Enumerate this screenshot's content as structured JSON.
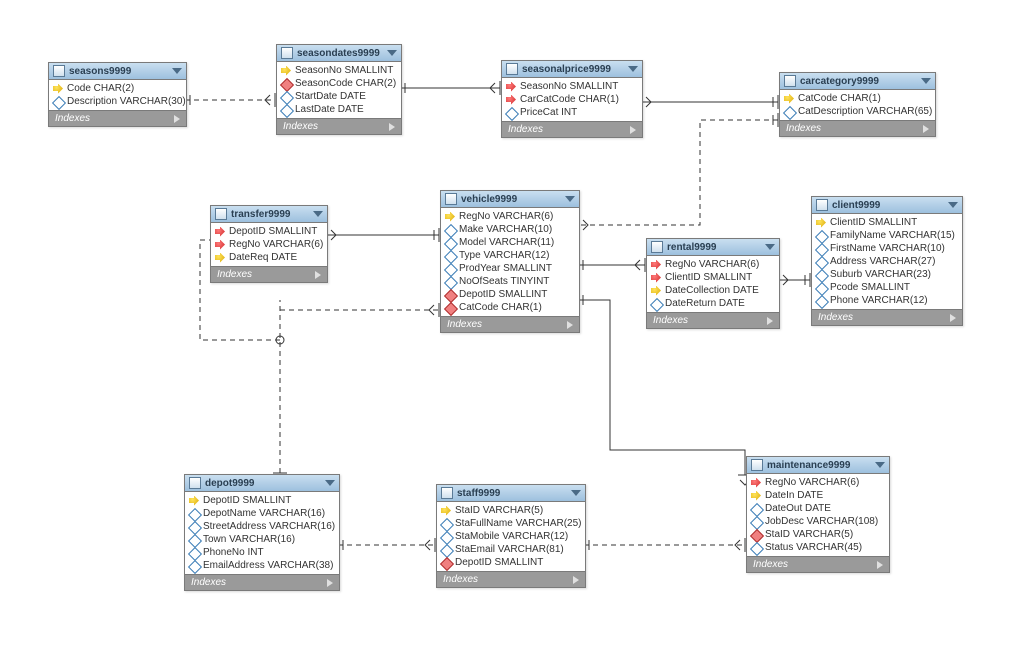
{
  "tables": {
    "seasons": {
      "title": "seasons9999",
      "cols": [
        {
          "icon": "key yellow",
          "text": "Code CHAR(2)"
        },
        {
          "icon": "diamond hollow",
          "text": "Description VARCHAR(30)"
        }
      ],
      "footer": "Indexes"
    },
    "seasondates": {
      "title": "seasondates9999",
      "cols": [
        {
          "icon": "key yellow",
          "text": "SeasonNo SMALLINT"
        },
        {
          "icon": "diamond red",
          "text": "SeasonCode CHAR(2)"
        },
        {
          "icon": "diamond hollow",
          "text": "StartDate DATE"
        },
        {
          "icon": "diamond hollow",
          "text": "LastDate DATE"
        }
      ],
      "footer": "Indexes"
    },
    "seasonalprice": {
      "title": "seasonalprice9999",
      "cols": [
        {
          "icon": "key red",
          "text": "SeasonNo SMALLINT"
        },
        {
          "icon": "key red",
          "text": "CarCatCode CHAR(1)"
        },
        {
          "icon": "diamond hollow",
          "text": "PriceCat INT"
        }
      ],
      "footer": "Indexes"
    },
    "carcategory": {
      "title": "carcategory9999",
      "cols": [
        {
          "icon": "key yellow",
          "text": "CatCode CHAR(1)"
        },
        {
          "icon": "diamond hollow",
          "text": "CatDescription VARCHAR(65)"
        }
      ],
      "footer": "Indexes"
    },
    "transfer": {
      "title": "transfer9999",
      "cols": [
        {
          "icon": "key red",
          "text": "DepotID SMALLINT"
        },
        {
          "icon": "key red",
          "text": "RegNo VARCHAR(6)"
        },
        {
          "icon": "key yellow",
          "text": "DateReq DATE"
        }
      ],
      "footer": "Indexes"
    },
    "vehicle": {
      "title": "vehicle9999",
      "cols": [
        {
          "icon": "key yellow",
          "text": "RegNo VARCHAR(6)"
        },
        {
          "icon": "diamond hollow",
          "text": "Make VARCHAR(10)"
        },
        {
          "icon": "diamond hollow",
          "text": "Model VARCHAR(11)"
        },
        {
          "icon": "diamond hollow",
          "text": "Type VARCHAR(12)"
        },
        {
          "icon": "diamond hollow",
          "text": "ProdYear SMALLINT"
        },
        {
          "icon": "diamond hollow",
          "text": "NoOfSeats TINYINT"
        },
        {
          "icon": "diamond red",
          "text": "DepotID SMALLINT"
        },
        {
          "icon": "diamond red",
          "text": "CatCode CHAR(1)"
        }
      ],
      "footer": "Indexes"
    },
    "rental": {
      "title": "rental9999",
      "cols": [
        {
          "icon": "key red",
          "text": "RegNo VARCHAR(6)"
        },
        {
          "icon": "key red",
          "text": "ClientID SMALLINT"
        },
        {
          "icon": "key yellow",
          "text": "DateCollection DATE"
        },
        {
          "icon": "diamond hollow",
          "text": "DateReturn DATE"
        }
      ],
      "footer": "Indexes"
    },
    "client": {
      "title": "client9999",
      "cols": [
        {
          "icon": "key yellow",
          "text": "ClientID SMALLINT"
        },
        {
          "icon": "diamond hollow",
          "text": "FamilyName VARCHAR(15)"
        },
        {
          "icon": "diamond hollow",
          "text": "FirstName VARCHAR(10)"
        },
        {
          "icon": "diamond hollow",
          "text": "Address VARCHAR(27)"
        },
        {
          "icon": "diamond hollow",
          "text": "Suburb VARCHAR(23)"
        },
        {
          "icon": "diamond hollow",
          "text": "Pcode SMALLINT"
        },
        {
          "icon": "diamond hollow",
          "text": "Phone VARCHAR(12)"
        }
      ],
      "footer": "Indexes"
    },
    "depot": {
      "title": "depot9999",
      "cols": [
        {
          "icon": "key yellow",
          "text": "DepotID SMALLINT"
        },
        {
          "icon": "diamond hollow",
          "text": "DepotName VARCHAR(16)"
        },
        {
          "icon": "diamond hollow",
          "text": "StreetAddress VARCHAR(16)"
        },
        {
          "icon": "diamond hollow",
          "text": "Town VARCHAR(16)"
        },
        {
          "icon": "diamond hollow",
          "text": "PhoneNo INT"
        },
        {
          "icon": "diamond hollow",
          "text": "EmailAddress VARCHAR(38)"
        }
      ],
      "footer": "Indexes"
    },
    "staff": {
      "title": "staff9999",
      "cols": [
        {
          "icon": "key yellow",
          "text": "StaID VARCHAR(5)"
        },
        {
          "icon": "diamond hollow",
          "text": "StaFullName VARCHAR(25)"
        },
        {
          "icon": "diamond hollow",
          "text": "StaMobile VARCHAR(12)"
        },
        {
          "icon": "diamond hollow",
          "text": "StaEmail VARCHAR(81)"
        },
        {
          "icon": "diamond red",
          "text": "DepotID SMALLINT"
        }
      ],
      "footer": "Indexes"
    },
    "maintenance": {
      "title": "maintenance9999",
      "cols": [
        {
          "icon": "key red",
          "text": "RegNo VARCHAR(6)"
        },
        {
          "icon": "key yellow",
          "text": "DateIn DATE"
        },
        {
          "icon": "diamond hollow",
          "text": "DateOut DATE"
        },
        {
          "icon": "diamond hollow",
          "text": "JobDesc VARCHAR(108)"
        },
        {
          "icon": "diamond red",
          "text": "StaID VARCHAR(5)"
        },
        {
          "icon": "diamond hollow",
          "text": "Status VARCHAR(45)"
        }
      ],
      "footer": "Indexes"
    }
  },
  "relationships": [
    {
      "from": "seasons.Code",
      "to": "seasondates.SeasonCode",
      "style": "dashed"
    },
    {
      "from": "seasondates.SeasonNo",
      "to": "seasonalprice.SeasonNo",
      "style": "solid"
    },
    {
      "from": "carcategory.CatCode",
      "to": "seasonalprice.CarCatCode",
      "style": "solid"
    },
    {
      "from": "carcategory.CatCode",
      "to": "vehicle.CatCode",
      "style": "dashed"
    },
    {
      "from": "vehicle.RegNo",
      "to": "transfer.RegNo",
      "style": "solid"
    },
    {
      "from": "vehicle.RegNo",
      "to": "rental.RegNo",
      "style": "solid"
    },
    {
      "from": "vehicle.RegNo",
      "to": "maintenance.RegNo",
      "style": "solid"
    },
    {
      "from": "client.ClientID",
      "to": "rental.ClientID",
      "style": "solid"
    },
    {
      "from": "depot.DepotID",
      "to": "transfer.DepotID",
      "style": "dashed"
    },
    {
      "from": "depot.DepotID",
      "to": "vehicle.DepotID",
      "style": "dashed"
    },
    {
      "from": "depot.DepotID",
      "to": "staff.DepotID",
      "style": "dashed"
    },
    {
      "from": "staff.StaID",
      "to": "maintenance.StaID",
      "style": "dashed"
    }
  ]
}
